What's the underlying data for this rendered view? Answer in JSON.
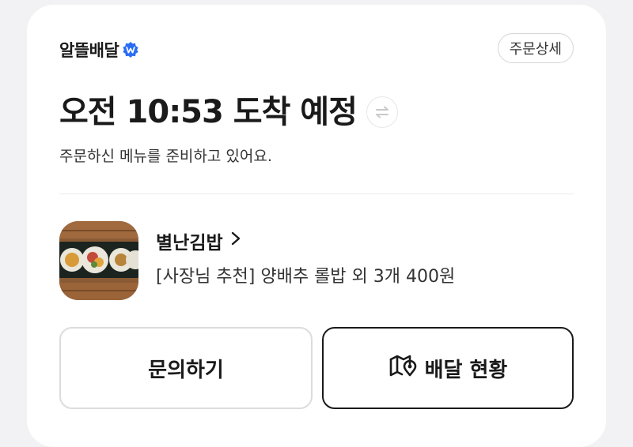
{
  "brand": {
    "name": "알뜰배달",
    "badge_icon": "verified-w-icon",
    "badge_color": "#2a6df4"
  },
  "header": {
    "detail_label": "주문상세"
  },
  "eta": {
    "text": "오전 10:53 도착 예정",
    "swap_icon": "swap-arrows-icon"
  },
  "status_message": "주문하신 메뉴를 준비하고 있어요.",
  "store": {
    "name": "별난김밥",
    "chevron_icon": "chevron-right-icon",
    "thumbnail": "gimbap-thumbnail",
    "order_summary": "[사장님 추천] 양배추 롤밥 외 3개 400원"
  },
  "actions": {
    "inquiry_label": "문의하기",
    "delivery_status_label": "배달 현황",
    "delivery_status_icon": "map-pin-icon"
  }
}
